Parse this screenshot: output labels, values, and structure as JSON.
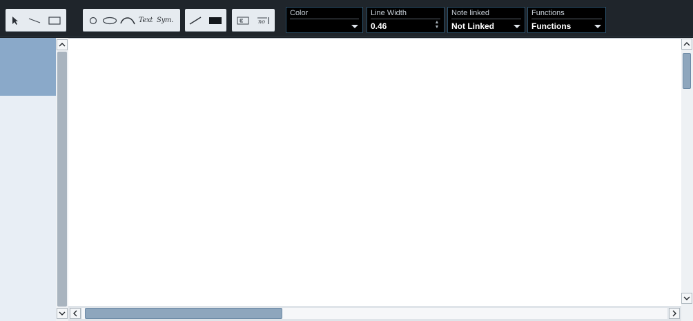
{
  "toolbar": {
    "tools": [
      {
        "name": "select-icon"
      },
      {
        "name": "line-icon"
      },
      {
        "name": "rectangle-icon"
      },
      {
        "name": "circle-icon"
      },
      {
        "name": "ellipse-icon"
      },
      {
        "name": "curve-icon"
      },
      {
        "name": "text-tool"
      },
      {
        "name": "symbol-tool"
      },
      {
        "name": "line-style-icon"
      },
      {
        "name": "fill-icon"
      },
      {
        "name": "frame-icon"
      },
      {
        "name": "no-frame-icon"
      }
    ],
    "text_tool_label": "Text",
    "symbol_tool_label": "Sym."
  },
  "fields": {
    "color": {
      "label": "Color",
      "value": ""
    },
    "line_width": {
      "label": "Line Width",
      "value": "0.46"
    },
    "note_linked": {
      "label": "Note linked",
      "value": "Not Linked"
    },
    "functions": {
      "label": "Functions",
      "value": "Functions"
    }
  },
  "colors": {
    "toolbar_bg": "#1f252b",
    "field_border": "#2b4f69",
    "selected_row": "#8aa9c9",
    "scroll_thumb": "#8ea6bd"
  }
}
